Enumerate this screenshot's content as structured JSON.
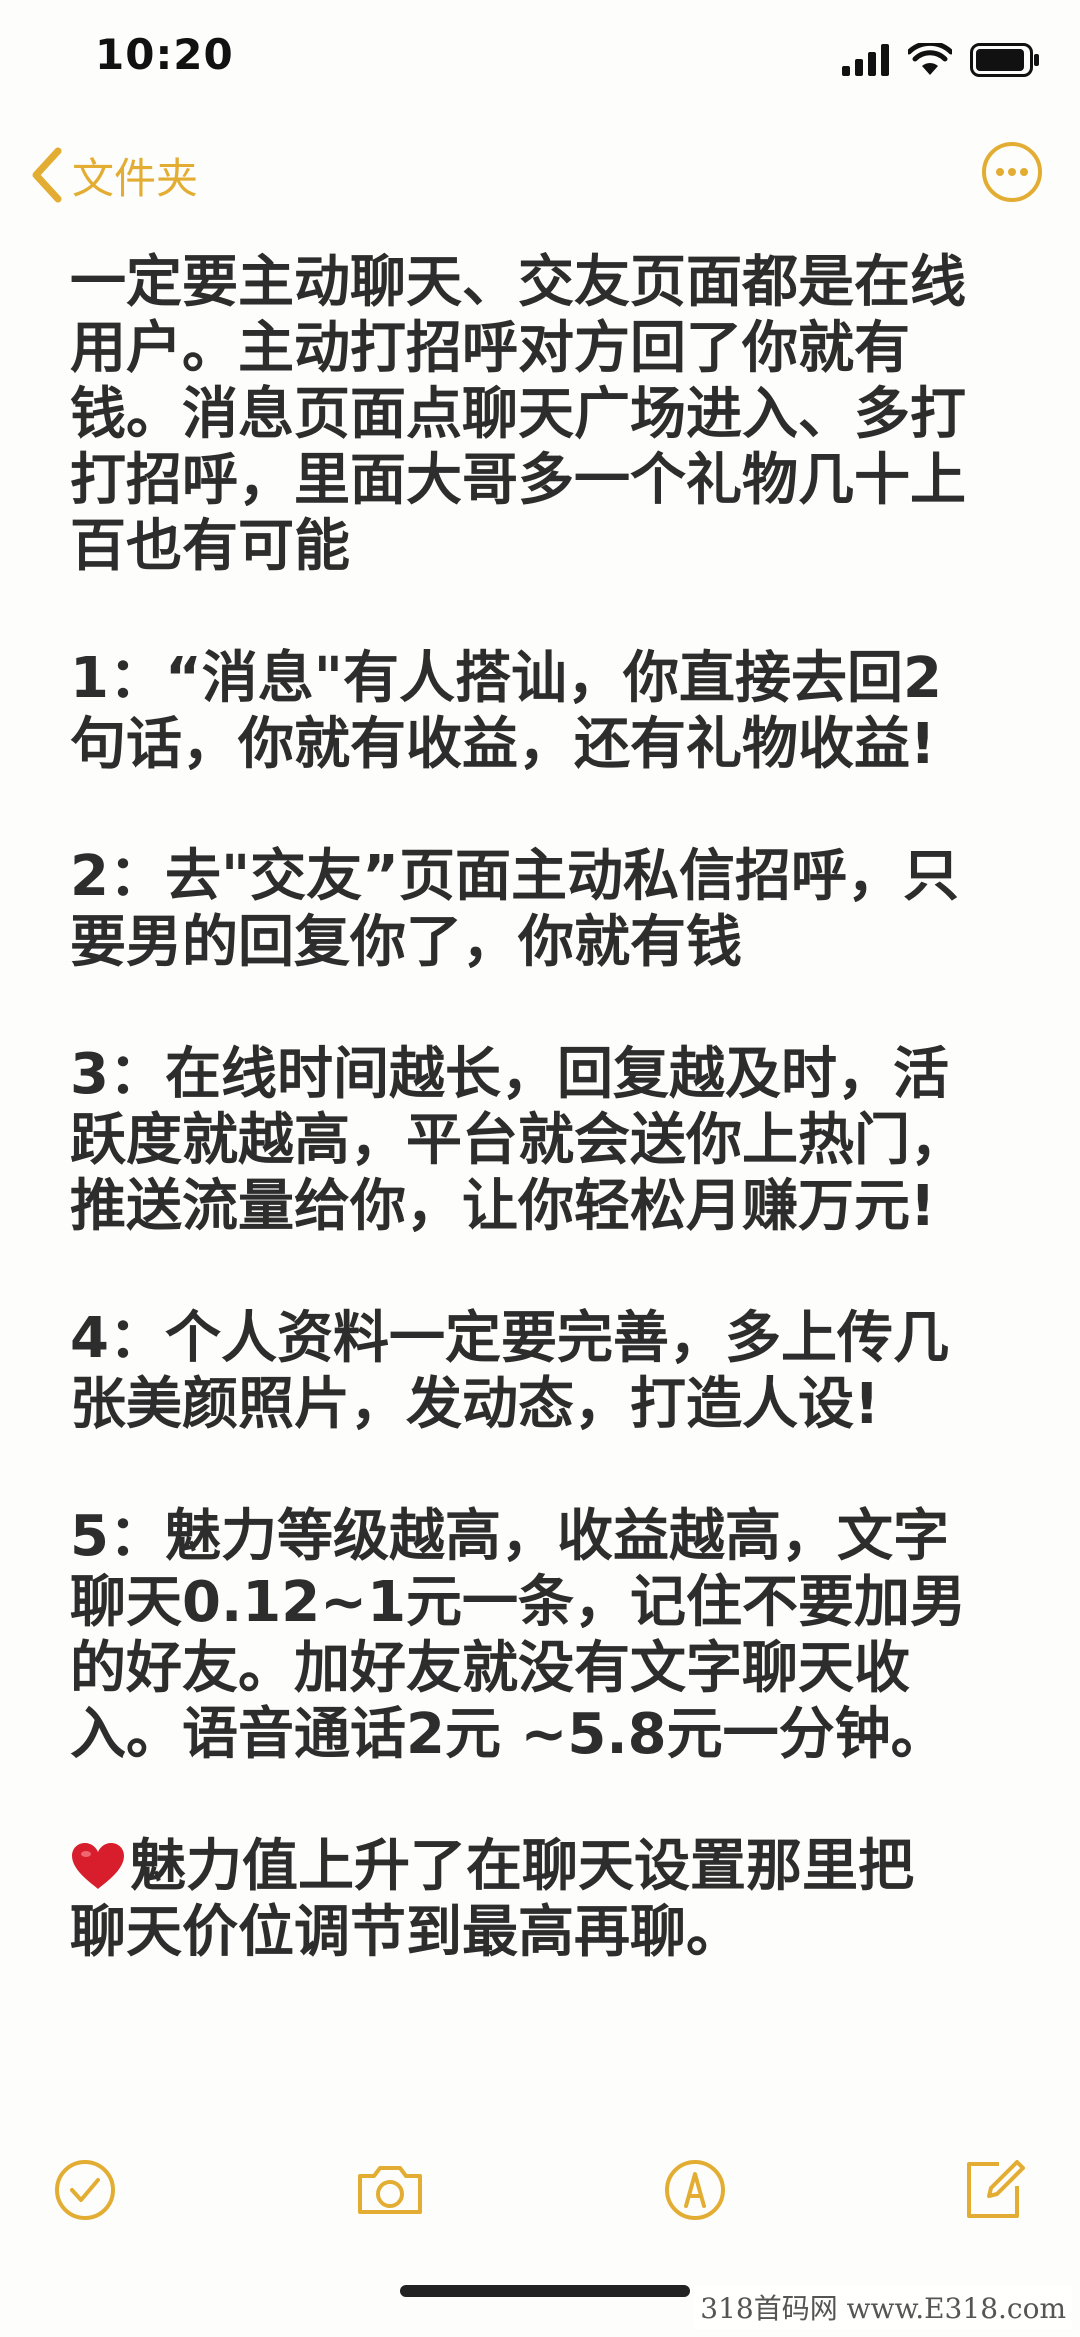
{
  "status_bar": {
    "time": "10:20",
    "icons": [
      "cellular-signal-icon",
      "wifi-icon",
      "battery-icon"
    ]
  },
  "nav": {
    "back_label": "文件夹",
    "icons": [
      "chevron-left-icon",
      "more-options-icon"
    ]
  },
  "note": {
    "paragraphs": [
      "一定要主动聊天、交友页面都是在线\n用户。主动打招呼对方回了你就有\n钱。消息页面点聊天广场进入、多打\n打招呼，里面大哥多一个礼物几十上\n百也有可能",
      "1：“消息\"有人搭讪，你直接去回2\n句话，你就有收益，还有礼物收益!",
      "2：去\"交友”页面主动私信招呼，只\n要男的回复你了，你就有钱",
      "3：在线时间越长，回复越及时，活\n跃度就越高，平台就会送你上热门，\n推送流量给你，让你轻松月赚万元!",
      "4：个人资料一定要完善，多上传几\n张美颜照片，发动态，打造人设!",
      "5：魅力等级越高，收益越高，文字\n聊天0.12~1元一条，记住不要加男\n的好友。加好友就没有文字聊天收\n入。语音通话2元 ~5.8元一分钟。",
      "魅力值上升了在聊天设置那里把\n聊天价位调节到最高再聊。"
    ]
  },
  "toolbar": {
    "icons": [
      "checklist-icon",
      "camera-icon",
      "markup-icon",
      "compose-icon"
    ]
  },
  "watermark": "318首码网 www.E318.com",
  "colors": {
    "accent": "#e2ad32",
    "text": "#2d2d2d",
    "background": "#fdfdfb",
    "heart": "#d81e2c"
  }
}
